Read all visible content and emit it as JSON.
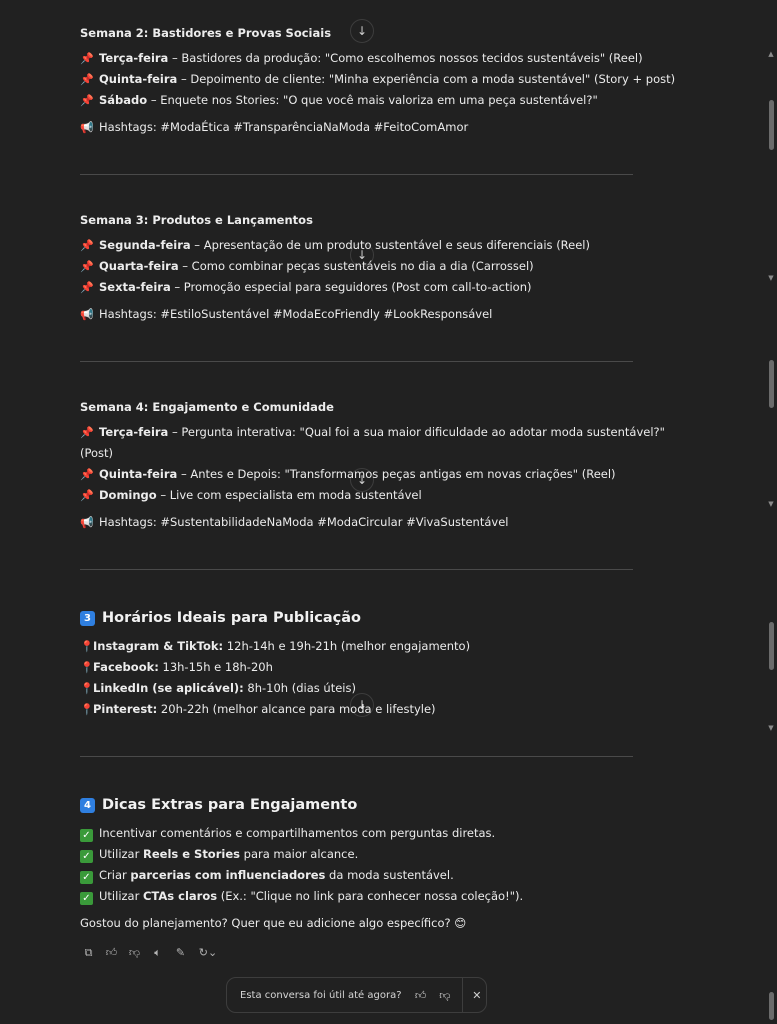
{
  "weeks": [
    {
      "title": "Semana 2: Bastidores e Provas Sociais",
      "items": [
        {
          "day": "Terça-feira",
          "text": " – Bastidores da produção: \"Como escolhemos nossos tecidos sustentáveis\" (Reel)"
        },
        {
          "day": "Quinta-feira",
          "text": " – Depoimento de cliente: \"Minha experiência com a moda sustentável\" (Story + post)"
        },
        {
          "day": "Sábado",
          "text": " – Enquete nos Stories: \"O que você mais valoriza em uma peça sustentável?\""
        }
      ],
      "hashtags": "Hashtags: #ModaÉtica #TransparênciaNaModa #FeitoComAmor"
    },
    {
      "title": "Semana 3: Produtos e Lançamentos",
      "items": [
        {
          "day": "Segunda-feira",
          "text": " – Apresentação de um produto sustentável e seus diferenciais (Reel)"
        },
        {
          "day": "Quarta-feira",
          "text": " – Como combinar peças sustentáveis no dia a dia (Carrossel)"
        },
        {
          "day": "Sexta-feira",
          "text": " – Promoção especial para seguidores (Post com call-to-action)"
        }
      ],
      "hashtags": "Hashtags: #EstiloSustentável #ModaEcoFriendly #LookResponsável"
    },
    {
      "title": "Semana 4: Engajamento e Comunidade",
      "items": [
        {
          "day": "Terça-feira",
          "text": " – Pergunta interativa: \"Qual foi a sua maior dificuldade ao adotar moda sustentável?\"",
          "cont": "(Post)"
        },
        {
          "day": "Quinta-feira",
          "text": " – Antes e Depois: \"Transformamos peças antigas em novas criações\" (Reel)"
        },
        {
          "day": "Domingo",
          "text": " – Live com especialista em moda sustentável"
        }
      ],
      "hashtags": "Hashtags: #SustentabilidadeNaModa #ModaCircular #VivaSustentável"
    }
  ],
  "section3": {
    "badge": "3",
    "title": "Horários Ideais para Publicação",
    "items": [
      {
        "label": "Instagram & TikTok:",
        "text": " 12h-14h e 19h-21h (melhor engajamento)"
      },
      {
        "label": "Facebook:",
        "text": " 13h-15h e 18h-20h"
      },
      {
        "label": "LinkedIn (se aplicável):",
        "text": " 8h-10h (dias úteis)"
      },
      {
        "label": "Pinterest:",
        "text": " 20h-22h (melhor alcance para moda e lifestyle)"
      }
    ]
  },
  "section4": {
    "badge": "4",
    "title": "Dicas Extras para Engajamento",
    "items": [
      {
        "a": "Incentivar comentários e compartilhamentos com perguntas diretas.",
        "b": "",
        "c": ""
      },
      {
        "a": "Utilizar ",
        "b": "Reels e Stories",
        "c": " para maior alcance."
      },
      {
        "a": "Criar ",
        "b": "parcerias com influenciadores",
        "c": " da moda sustentável."
      },
      {
        "a": "Utilizar ",
        "b": "CTAs claros",
        "c": " (Ex.: \"Clique no link para conhecer nossa coleção!\")."
      }
    ]
  },
  "closing": "Gostou do planejamento? Quer que eu adicione algo específico? 😊",
  "feedback": {
    "question": "Esta conversa foi útil até agora?"
  },
  "icons": {
    "pin": "pushpin-icon",
    "megaphone": "megaphone-icon",
    "location": "round-pushpin-icon",
    "check": "check-mark-icon",
    "copy": "copy-icon",
    "thumbs_up": "thumbs-up-icon",
    "thumbs_down": "thumbs-down-icon",
    "speaker": "read-aloud-icon",
    "edit": "edit-icon",
    "regenerate": "regenerate-icon",
    "close": "close-icon"
  },
  "colors": {
    "background": "#212121",
    "text": "#ececec",
    "pin": "#e0463b",
    "badge": "#2f7fe0",
    "check": "#3a9a3a"
  }
}
